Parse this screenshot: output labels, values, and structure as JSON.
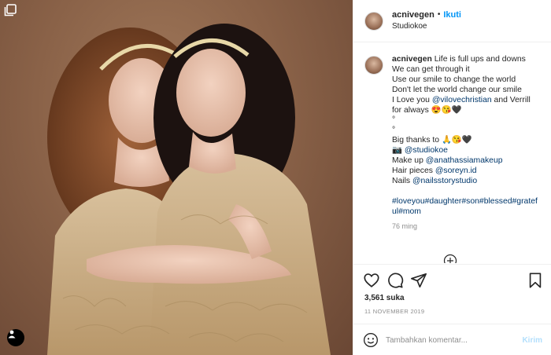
{
  "post": {
    "photo_alt": "Two people in matching gold lace dresses embracing",
    "carousel_icon": "multiple-photos-icon",
    "tag_icon": "user-tag-icon"
  },
  "header": {
    "username": "acnivegen",
    "separator": "•",
    "follow_label": "Ikuti",
    "location": "Studiokoe"
  },
  "caption": {
    "username": "acnivegen",
    "first_line": "Life is full ups and downs",
    "lines_a": [
      "We can get through it",
      "Use our smile to change the world",
      "Don't let the world change our smile"
    ],
    "love_prefix": "I Love you ",
    "mention_vilove": "@vilovechristian",
    "love_suffix": " and Verrill",
    "always_line": "for always 😍😘🖤",
    "spacer_1": "°",
    "spacer_2": "°",
    "thanks_line": "Big thanks to 🙏😘🖤",
    "camera_emoji": "📷",
    "mention_studio": "@studiokoe",
    "makeup_prefix": "Make up ",
    "mention_makeup": "@anathassiamakeup",
    "hair_prefix": "Hair pieces ",
    "mention_hair": "@soreyn.id",
    "nails_prefix": "Nails ",
    "mention_nails": "@nailsstorystudio",
    "hashtags": "#loveyou#daughter#son#blessed#grateful#mom",
    "time_ago": "76 ming"
  },
  "actions": {
    "icons": [
      "heart-icon",
      "comment-icon",
      "share-icon",
      "save-icon"
    ],
    "likes": "3,561 suka",
    "date": "11 NOVEMBER 2019"
  },
  "comment": {
    "placeholder": "Tambahkan komentar...",
    "post_label": "Kirim"
  },
  "colors": {
    "link": "#00376b",
    "follow": "#0095f6",
    "muted": "#8e8e8e",
    "photo_bg": "#8a6248",
    "dress_gold": "#c9ae86"
  }
}
